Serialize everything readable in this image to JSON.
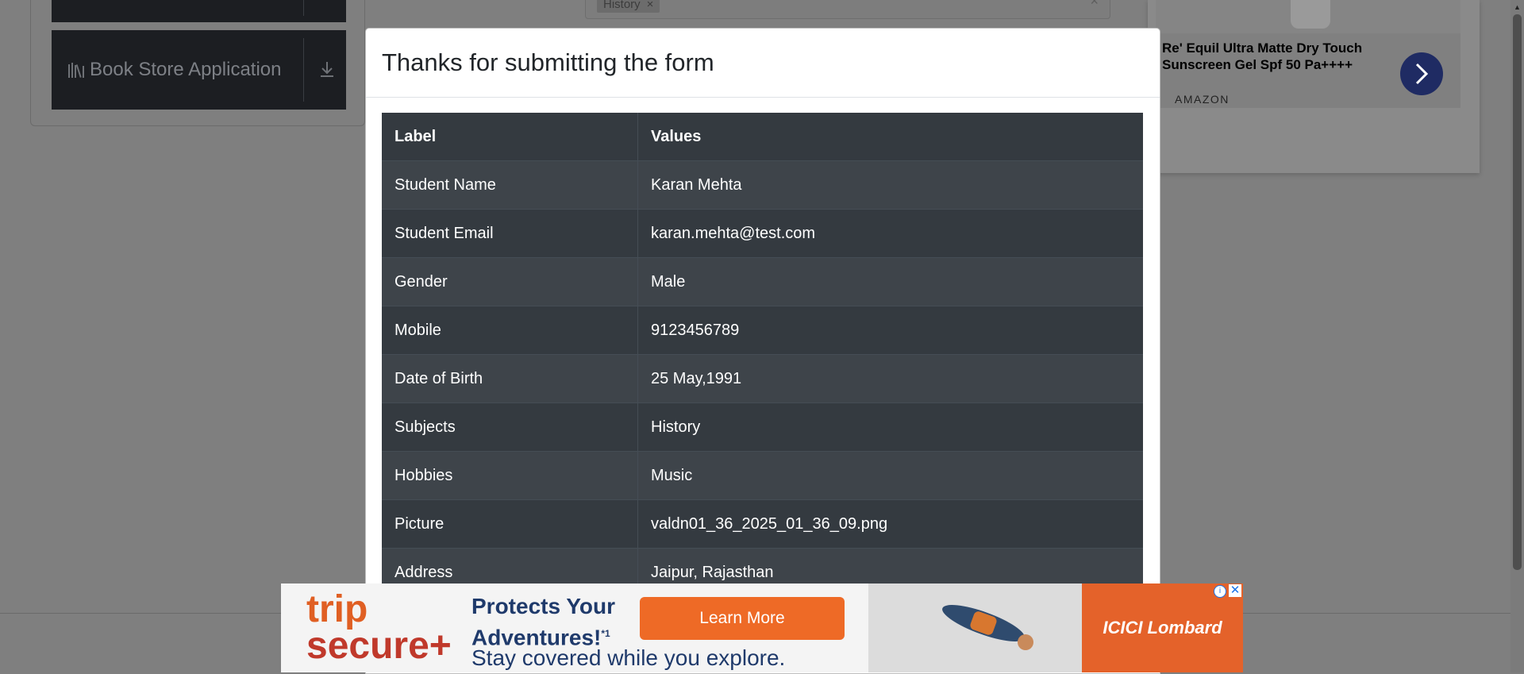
{
  "background": {
    "sidebar": {
      "book_store_label": "Book Store Application"
    },
    "form": {
      "subject_chip": "History",
      "chip_remove": "×",
      "clear": "×"
    },
    "side_ad": {
      "title": "Re' Equil Ultra Matte Dry Touch Sunscreen Gel Spf 50 Pa++++",
      "brand": "AMAZON"
    }
  },
  "modal": {
    "title": "Thanks for submitting the form",
    "table": {
      "headers": [
        "Label",
        "Values"
      ],
      "rows": [
        [
          "Student Name",
          "Karan Mehta"
        ],
        [
          "Student Email",
          "karan.mehta@test.com"
        ],
        [
          "Gender",
          "Male"
        ],
        [
          "Mobile",
          "9123456789"
        ],
        [
          "Date of Birth",
          "25 May,1991"
        ],
        [
          "Subjects",
          "History"
        ],
        [
          "Hobbies",
          "Music"
        ],
        [
          "Picture",
          "valdn01_36_2025_01_36_09.png"
        ],
        [
          "Address",
          "Jaipur, Rajasthan"
        ]
      ]
    }
  },
  "bottom_ad": {
    "logo_line1": "trip",
    "logo_line2": "secure+",
    "headline_1": "Protects Your",
    "headline_2": "Adventures!",
    "headline_sup": "*1",
    "subline": "Stay covered while you explore.",
    "cta": "Learn More",
    "brand": "ICICI Lombard"
  },
  "colors": {
    "overlay": "#7f7f7f",
    "table_dark": "#343a40",
    "table_stripe": "#3e444a",
    "ad_orange": "#ee6a26"
  }
}
